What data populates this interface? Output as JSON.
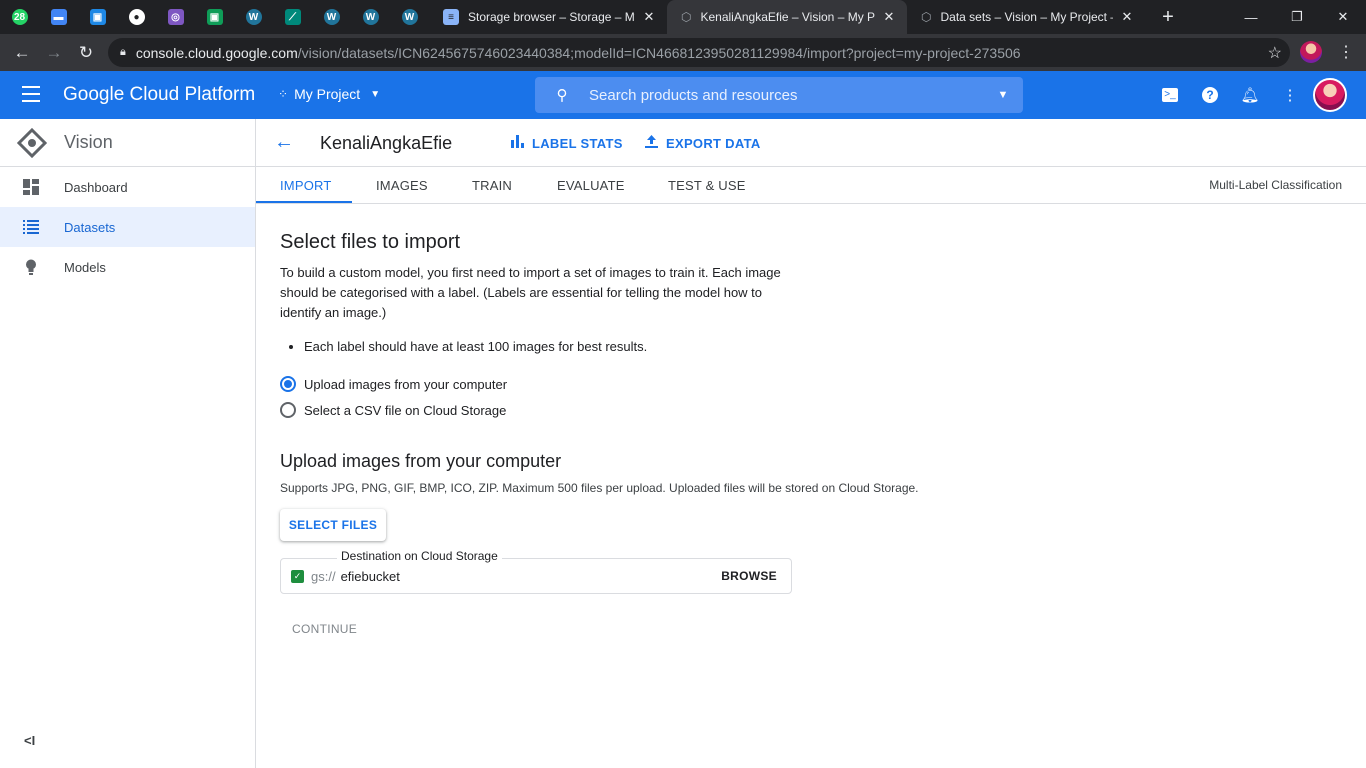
{
  "browser": {
    "tabs": [
      {
        "title": "Storage browser – Storage – My P",
        "active": false
      },
      {
        "title": "KenaliAngkaEfie – Vision – My Pr",
        "active": true
      },
      {
        "title": "Data sets – Vision – My Project –",
        "active": false
      }
    ],
    "pinned_tabs": [
      {
        "icon": "whatsapp-icon",
        "badge": "28",
        "color": "#25d366"
      },
      {
        "icon": "bookmark-icon",
        "color": "#4285f4"
      },
      {
        "icon": "classroom-icon",
        "color": "#1e88e5"
      },
      {
        "icon": "github-icon",
        "color": "#ffffff"
      },
      {
        "icon": "site-icon",
        "color": "#7e57c2"
      },
      {
        "icon": "classroom-green-icon",
        "color": "#0f9d58"
      },
      {
        "icon": "wordpress-icon",
        "color": "#21759b"
      },
      {
        "icon": "feather-icon",
        "color": "#00897b"
      },
      {
        "icon": "wordpress-icon",
        "color": "#21759b"
      },
      {
        "icon": "wordpress-icon",
        "color": "#21759b"
      },
      {
        "icon": "wordpress-icon",
        "color": "#21759b"
      }
    ],
    "url_host": "console.cloud.google.com",
    "url_path": "/vision/datasets/ICN6245675746023440384;modelId=ICN4668123950281129984/import?project=my-project-273506"
  },
  "header": {
    "title": "Google Cloud Platform",
    "project": "My Project",
    "search_placeholder": "Search products and resources",
    "accent": "#1a73e8"
  },
  "sidebar": {
    "title": "Vision",
    "items": [
      {
        "label": "Dashboard",
        "icon": "dashboard-icon",
        "active": false
      },
      {
        "label": "Datasets",
        "icon": "list-icon",
        "active": true
      },
      {
        "label": "Models",
        "icon": "lightbulb-icon",
        "active": false
      }
    ]
  },
  "dataset": {
    "name": "KenaliAngkaEfie",
    "label_stats": "LABEL STATS",
    "export_data": "EXPORT DATA",
    "classification": "Multi-Label Classification"
  },
  "tabs": [
    "IMPORT",
    "IMAGES",
    "TRAIN",
    "EVALUATE",
    "TEST & USE"
  ],
  "import": {
    "title": "Select files to import",
    "description": "To build a custom model, you first need to import a set of images to train it. Each image should be categorised with a label. (Labels are essential for telling the model how to identify an image.)",
    "bullet": "Each label should have at least 100 images for best results.",
    "options": [
      {
        "label": "Upload images from your computer",
        "selected": true
      },
      {
        "label": "Select a CSV file on Cloud Storage",
        "selected": false
      }
    ],
    "upload_title": "Upload images from your computer",
    "supports": "Supports JPG, PNG, GIF, BMP, ICO, ZIP. Maximum 500 files per upload. Uploaded files will be stored on Cloud Storage.",
    "select_files": "SELECT FILES",
    "destination_label": "Destination on Cloud Storage",
    "gs_prefix": "gs://",
    "bucket": "efiebucket",
    "browse": "BROWSE",
    "continue": "CONTINUE"
  }
}
